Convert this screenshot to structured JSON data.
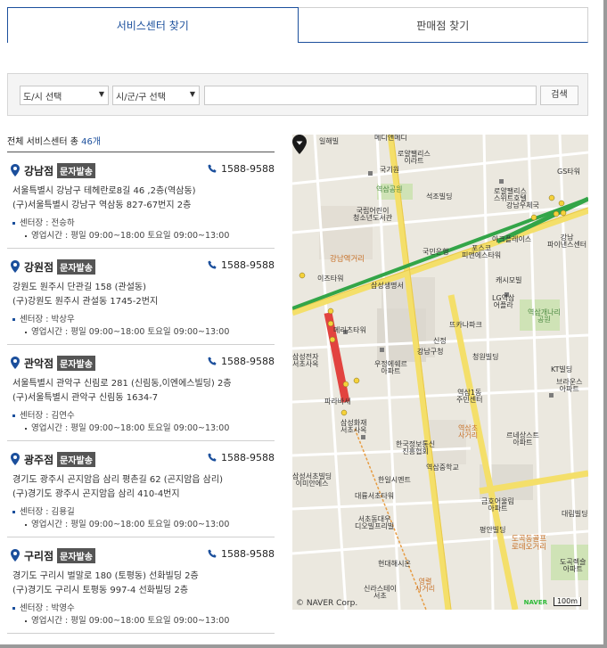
{
  "tabs": {
    "service_center": "서비스센터 찾기",
    "store": "판매점 찾기"
  },
  "search": {
    "province_select": "도/시 선택",
    "city_select": "시/군/구 선택",
    "keyword_value": "",
    "button": "검색"
  },
  "list_header": {
    "prefix": "전체 서비스센터 총",
    "count": "46개"
  },
  "centers": [
    {
      "name": "강남점",
      "badge": "문자발송",
      "phone": "1588-9588",
      "address": "서울특별시 강남구 테헤란로8길 46 ,2층(역삼동)",
      "old_address": "(구)서울특별시 강남구 역삼동 827-67번지 2층",
      "manager": "센터장 : 전승하",
      "hours": "영업시간 : 평일 09:00~18:00 토요일 09:00~13:00"
    },
    {
      "name": "강원점",
      "badge": "문자발송",
      "phone": "1588-9588",
      "address": "강원도 원주시 단관길 158 (관설동)",
      "old_address": "(구)강원도 원주시 관설동 1745-2번지",
      "manager": "센터장 : 박상우",
      "hours": "영업시간 : 평일 09:00~18:00 토요일 09:00~13:00"
    },
    {
      "name": "관악점",
      "badge": "문자발송",
      "phone": "1588-9588",
      "address": "서울특별시 관악구 신림로 281 (신림동,이엔에스빌딩) 2층",
      "old_address": "(구)서울특별시 관악구 신림동 1634-7",
      "manager": "센터장 : 김연수",
      "hours": "영업시간 : 평일 09:00~18:00 토요일 09:00~13:00"
    },
    {
      "name": "광주점",
      "badge": "문자발송",
      "phone": "1588-9588",
      "address": "경기도 광주시 곤지암읍 삼리 평촌길 62 (곤지암읍 삼리)",
      "old_address": "(구)경기도 광주시 곤지암읍 삼리 410-4번지",
      "manager": "센터장 : 김용길",
      "hours": "영업시간 : 평일 09:00~18:00 토요일 09:00~13:00"
    },
    {
      "name": "구리점",
      "badge": "문자발송",
      "phone": "1588-9588",
      "address": "경기도 구리시 벌말로 180 (토평동) 선화빌딩 2층",
      "old_address": "(구)경기도 구리시 토평동 997-4 선화빌딩 2층",
      "manager": "센터장 : 박영수",
      "hours": "영업시간 : 평일 09:00~18:00 토요일 09:00~13:00"
    }
  ],
  "map": {
    "copyright": "© NAVER Corp.",
    "brand": "NAVER",
    "scale": "100m",
    "labels": {
      "l1": "일해빌",
      "l2": "메디앤메디",
      "l3": "로얄팰리스\n이라트",
      "l4": "국기원",
      "l5": "GS타워",
      "l6": "역삼공원",
      "l7": "석조빌딩",
      "l8": "로얄팰리스\n스위트호텔",
      "l9": "강남우체국",
      "l10": "국립어린이\n청소년도서관",
      "l11": "아크플레이스",
      "l12": "강남\n파이낸스센터",
      "l13": "국민은행",
      "l14": "포스코\n피앤에스타워",
      "l15": "강남역거리",
      "l16": "이즈타워",
      "l17": "삼성생명서",
      "l18": "캐시모빌",
      "l19": "LG역삼\n어플라",
      "l20": "역삼개나리\n공원",
      "l21": "메리츠타워",
      "l22": "뜨카나파크",
      "l23": "청원빌딩",
      "l24": "신정",
      "l25": "강남구청",
      "l26": "삼성전자\n서초사옥",
      "l27": "우정에쉐르\n아파트",
      "l28": "KT빌딩",
      "l29": "역삼1동\n주민센터",
      "l30": "브라운스\n아파트",
      "l31": "파라바세",
      "l32": "삼성화재\n서초사옥",
      "l33": "역삼초\n사거리",
      "l34": "한국정보통신\n진흥협회",
      "l35": "르네상스트\n아파트",
      "l36": "역삼중학교",
      "l37": "한일시멘트",
      "l38": "대륭서초타워",
      "l39": "삼성서초빌딩\n이미안에스",
      "l40": "서초동대우\n디오빌프리빌",
      "l41": "금호어울림\n아파트",
      "l42": "평안빌딩",
      "l43": "도곡동골프\n로데오거리",
      "l44": "현대해시온",
      "l45": "대림빌딩",
      "l46": "신라스테이\n서초",
      "l47": "도곡렉슬\n아파트",
      "l48": "영렬\n사거리"
    }
  },
  "colors": {
    "accent": "#1b4f9c",
    "badge_bg": "#555555",
    "line2_green": "#33a548",
    "sinbundang_red": "#e2433f",
    "map_road_yellow": "#f4df6a"
  }
}
